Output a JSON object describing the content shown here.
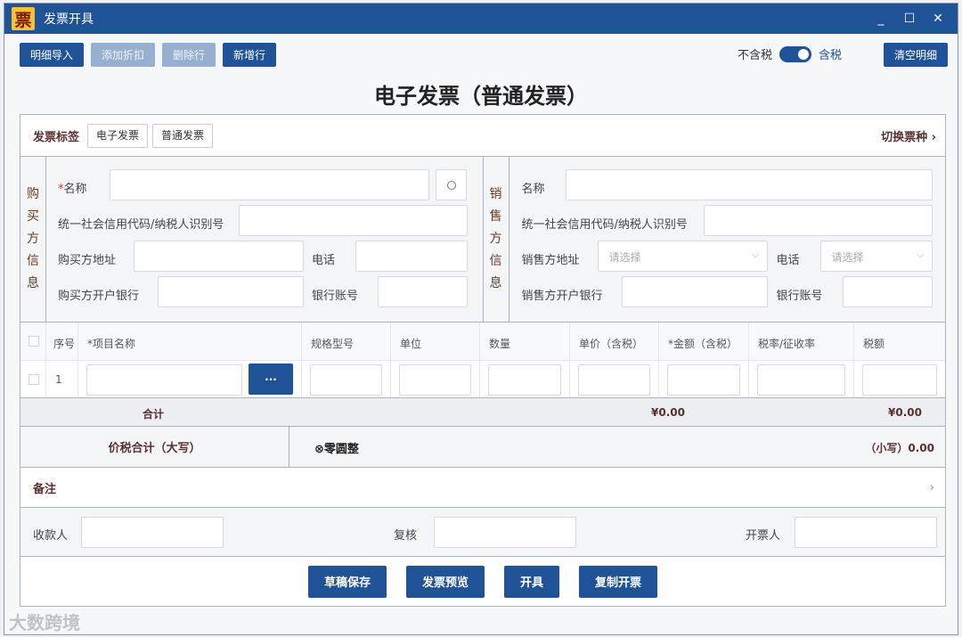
{
  "window": {
    "title": "发票开具",
    "icon_char": "票",
    "minimize": "_",
    "maximize": "☐",
    "close": "✕"
  },
  "toolbar": {
    "import": "明细导入",
    "add_discount": "添加折扣",
    "delete_row": "删除行",
    "add_row": "新增行"
  },
  "tax_toggle": {
    "off_label": "不含税",
    "on_label": "含税",
    "state": "on"
  },
  "clear_label": "清空明细",
  "doc_title": "电子发票（普通发票）",
  "tags": {
    "label": "发票标签",
    "items": [
      "电子发票",
      "普通发票"
    ],
    "switch_label": "切换票种 ›"
  },
  "buyer": {
    "vertical_label": [
      "购",
      "买",
      "方",
      "信",
      "息"
    ],
    "name_label": "名称",
    "required_mark": "*",
    "tax_id_label": "统一社会信用代码/纳税人识别号",
    "address_label": "购买方地址",
    "phone_label": "电话",
    "bank_label": "购买方开户银行",
    "account_label": "银行账号"
  },
  "seller": {
    "vertical_label": [
      "销",
      "售",
      "方",
      "信",
      "息"
    ],
    "name_label": "名称",
    "tax_id_label": "统一社会信用代码/纳税人识别号",
    "address_label": "销售方地址",
    "address_placeholder": "请选择",
    "phone_label": "电话",
    "phone_placeholder": "请选择",
    "bank_label": "销售方开户银行",
    "account_label": "银行账号"
  },
  "items": {
    "headers": [
      "序号",
      "*项目名称",
      "规格型号",
      "单位",
      "数量",
      "单价（含税）",
      "*金额（含税）",
      "税率/征收率",
      "税额"
    ],
    "rows": [
      {
        "index": "1",
        "more": "···"
      }
    ]
  },
  "totals": {
    "label": "合计",
    "amount": "¥0.00",
    "tax": "¥0.00"
  },
  "summary": {
    "label": "价税合计（大写）",
    "uppercase_icon": "⊗",
    "uppercase": "零圆整",
    "lowercase": "（小写）0.00"
  },
  "remarks": {
    "label": "备注",
    "arrow": "›"
  },
  "signatures": {
    "payee": "收款人",
    "reviewer": "复核",
    "issuer": "开票人"
  },
  "actions": {
    "save_draft": "草稿保存",
    "preview": "发票预览",
    "issue": "开具",
    "copy_issue": "复制开票"
  },
  "watermark": "大数跨境"
}
